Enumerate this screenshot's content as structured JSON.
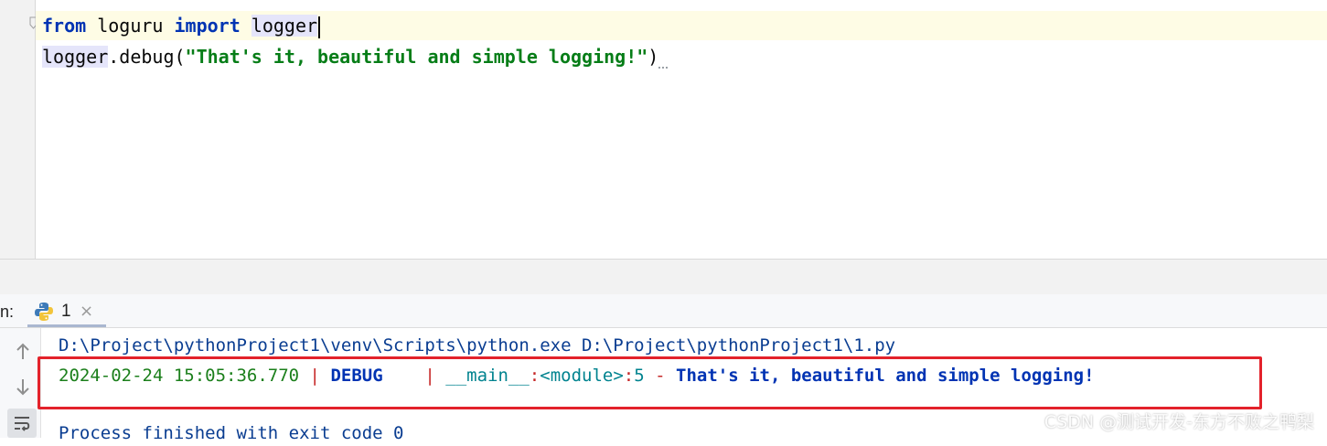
{
  "editor": {
    "line1": {
      "kw_from": "from",
      "module": " loguru ",
      "kw_import": "import",
      "space": " ",
      "name": "logger"
    },
    "line2": {
      "obj": "logger",
      "call": ".debug(",
      "string": "\"That's it, beautiful and simple logging!\"",
      "close": ")"
    }
  },
  "run_panel": {
    "label": "n:",
    "tab_title": "1",
    "tab_close": "×"
  },
  "console": {
    "command": "D:\\Project\\pythonProject1\\venv\\Scripts\\python.exe D:\\Project\\pythonProject1\\1.py",
    "log": {
      "timestamp": "2024-02-24 15:05:36.770",
      "sep1": " | ",
      "level": "DEBUG   ",
      "sep2": " | ",
      "name": "__main__",
      "colon1": ":",
      "function": "<module>",
      "colon2": ":",
      "line": "5",
      "dash": " - ",
      "message": "That's it, beautiful and simple logging!"
    },
    "exit": "Process finished with exit code 0"
  },
  "watermark": "CSDN @测试开发-东方不败之鸭梨",
  "colors": {
    "keyword": "#0033b3",
    "string": "#067d17",
    "timestamp": "#1b7f1b",
    "separator": "#c62828",
    "logger_name": "#00838f",
    "highlight_border": "#e3222b"
  },
  "icons": {
    "fold": "fold-marker-icon",
    "python": "python-icon",
    "up": "arrow-up-icon",
    "down": "arrow-down-icon",
    "wrap": "soft-wrap-icon"
  }
}
